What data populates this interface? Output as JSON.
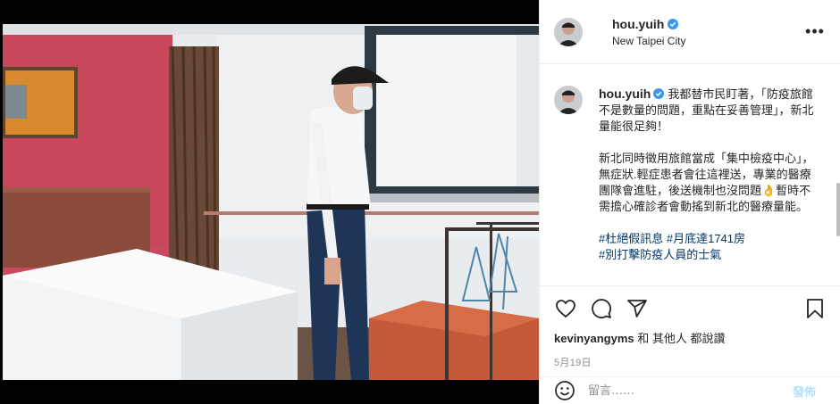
{
  "post": {
    "username": "hou.yuih",
    "location": "New Taipei City",
    "more_label": "•••"
  },
  "caption": {
    "username": "hou.yuih",
    "para1": "我都替市民盯著，「防疫旅館不是數量的問題，重點在妥善管理」，新北量能很足夠！",
    "para2": "新北同時徵用旅館當成「集中檢疫中心」，無症狀.輕症患者會往這裡送，專業的醫療團隊會進駐，後送機制也沒問題👌暫時不需擔心確診者會動搖到新北的醫療量能。",
    "tag1": "#杜絕假訊息",
    "tag2": "#月底達1741房",
    "tag3": "#別打擊防疫人員的士氣"
  },
  "actions": {
    "like_icon": "heart-icon",
    "comment_icon": "comment-icon",
    "share_icon": "send-icon",
    "save_icon": "bookmark-icon"
  },
  "likes": {
    "user": "kevinyangyms",
    "rest": "和 其他人 都說讚"
  },
  "date": "5月19日",
  "composer": {
    "placeholder": "留言……",
    "post_label": "發佈"
  },
  "colors": {
    "verified": "#3897f0",
    "link": "#00376b",
    "post_disabled": "#b2dffc"
  }
}
